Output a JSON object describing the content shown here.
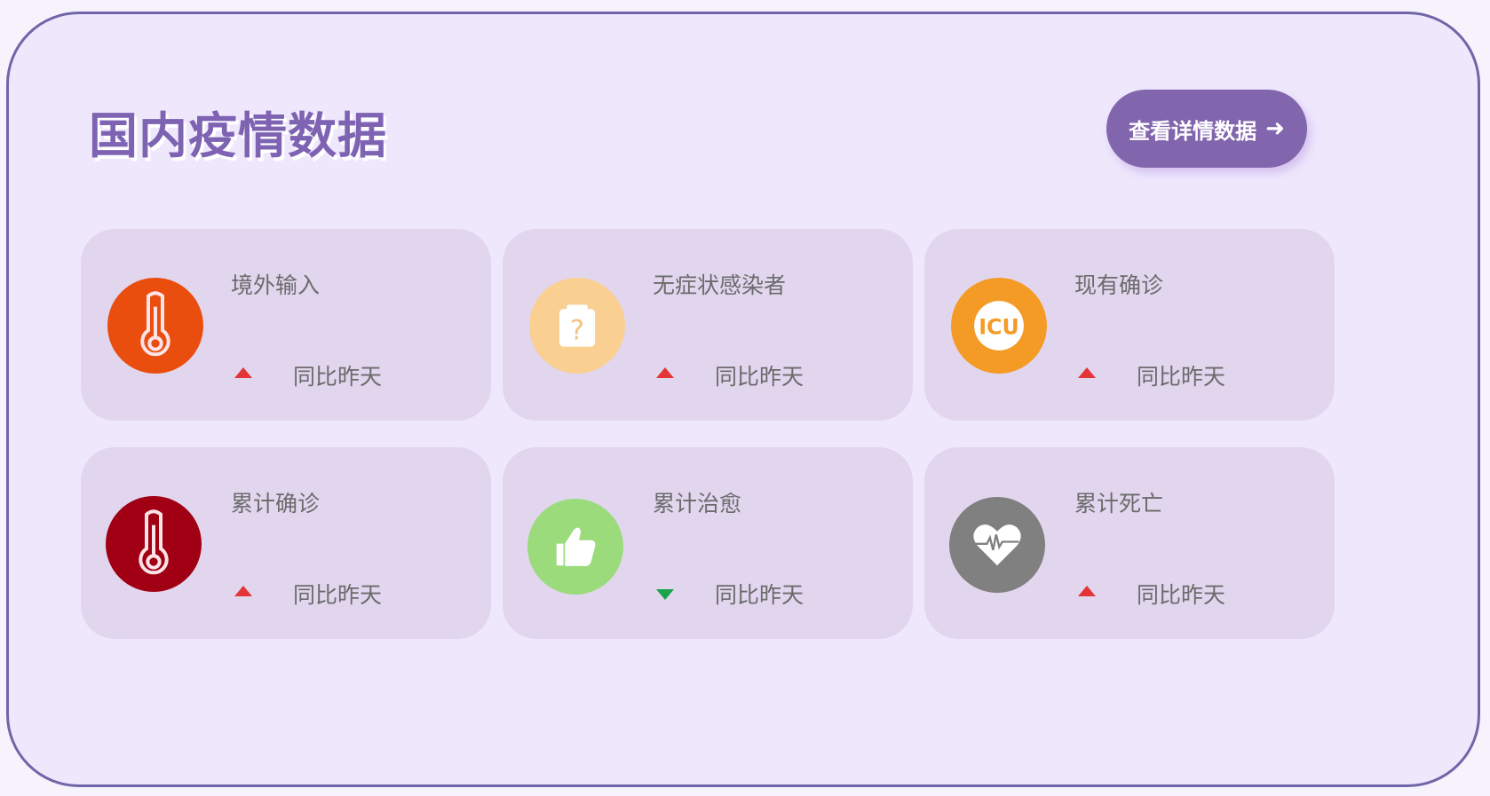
{
  "header": {
    "title": "国内疫情数据",
    "detail_button": "查看详情数据",
    "detail_button_icon": "arrow-right-icon"
  },
  "cards": [
    {
      "label": "境外输入",
      "icon": "thermometer-icon",
      "icon_color": "#e94e0f",
      "trend": "up",
      "compare": "同比昨天"
    },
    {
      "label": "无症状感染者",
      "icon": "question-clipboard-icon",
      "icon_color": "#f9cf92",
      "trend": "up",
      "compare": "同比昨天"
    },
    {
      "label": "现有确诊",
      "icon": "icu-icon",
      "icon_color": "#f49b26",
      "trend": "up",
      "compare": "同比昨天"
    },
    {
      "label": "累计确诊",
      "icon": "thermometer-icon",
      "icon_color": "#a10014",
      "trend": "up",
      "compare": "同比昨天"
    },
    {
      "label": "累计治愈",
      "icon": "thumbs-up-icon",
      "icon_color": "#9bdb7c",
      "trend": "down",
      "compare": "同比昨天"
    },
    {
      "label": "累计死亡",
      "icon": "heartbeat-icon",
      "icon_color": "#808080",
      "trend": "up",
      "compare": "同比昨天"
    }
  ],
  "colors": {
    "accent": "#8266ad",
    "trend_up": "#e33535",
    "trend_down": "#19a34a"
  }
}
